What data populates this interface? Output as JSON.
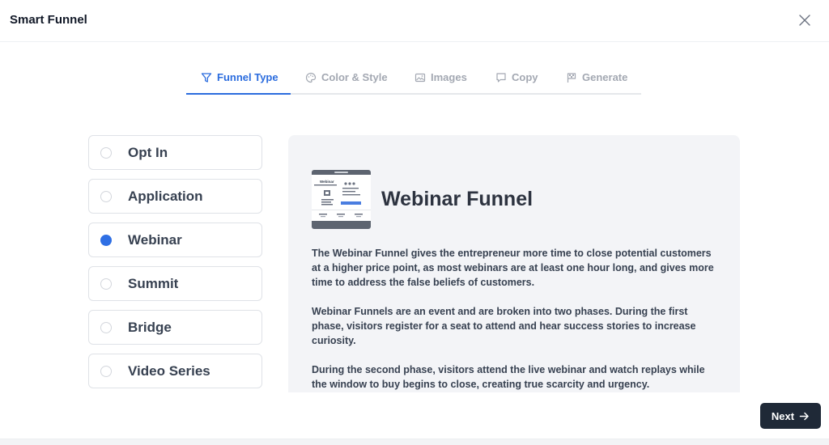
{
  "header": {
    "title": "Smart Funnel"
  },
  "tabs": [
    {
      "label": "Funnel Type",
      "icon": "funnel-icon"
    },
    {
      "label": "Color & Style",
      "icon": "palette-icon"
    },
    {
      "label": "Images",
      "icon": "image-icon"
    },
    {
      "label": "Copy",
      "icon": "chat-icon"
    },
    {
      "label": "Generate",
      "icon": "flag-icon"
    }
  ],
  "options": [
    {
      "label": "Opt In",
      "selected": false
    },
    {
      "label": "Application",
      "selected": false
    },
    {
      "label": "Webinar",
      "selected": true
    },
    {
      "label": "Summit",
      "selected": false
    },
    {
      "label": "Bridge",
      "selected": false
    },
    {
      "label": "Video Series",
      "selected": false
    }
  ],
  "panel": {
    "title": "Webinar Funnel",
    "thumb_label": "Webinar",
    "paragraphs": [
      "The Webinar Funnel gives the entrepreneur more time to close potential customers at a higher price point, as most webinars are at least one hour long, and gives more time to address the false beliefs of customers.",
      "Webinar Funnels are an event and are broken into two phases. During the first phase, visitors register for a seat to attend and hear success stories to increase curiosity.",
      "During the second phase, visitors attend the live webinar and watch replays while the window to buy begins to close, creating true scarcity and urgency."
    ]
  },
  "footer": {
    "next_label": "Next"
  },
  "colors": {
    "accent": "#2b6cde",
    "dark_button": "#1f2937",
    "panel_bg": "#f3f4f7"
  }
}
